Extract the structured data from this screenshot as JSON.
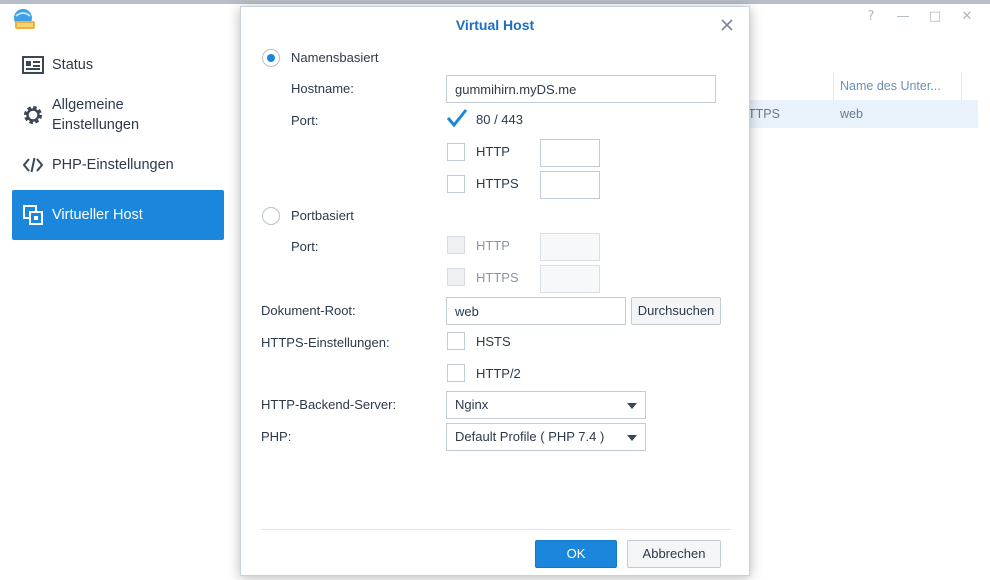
{
  "window": {
    "controls": [
      "?",
      "—",
      "□",
      "✕"
    ]
  },
  "sidebar": {
    "items": [
      {
        "label": "Status",
        "icon": "status-card-icon"
      },
      {
        "label": "Allgemeine Einstellungen",
        "line1": "Allgemeine",
        "line2": "Einstellungen",
        "icon": "gear-icon"
      },
      {
        "label": "PHP-Einstellungen",
        "icon": "code-brackets-icon"
      },
      {
        "label": "Virtueller Host",
        "icon": "virtual-host-icon",
        "active": true
      }
    ]
  },
  "background_table": {
    "headers": [
      "",
      "Name des Unter..."
    ],
    "rows": [
      [
        "TTPS",
        "web"
      ]
    ]
  },
  "dialog": {
    "title": "Virtual Host",
    "name_based": {
      "label": "Namensbasiert",
      "selected": true
    },
    "hostname": {
      "label": "Hostname:",
      "value": "gummihirn.myDS.me"
    },
    "port_label": "Port:",
    "port_default": {
      "label": "80 / 443",
      "checked": true
    },
    "port_http": {
      "label": "HTTP",
      "checked": false,
      "value": ""
    },
    "port_https": {
      "label": "HTTPS",
      "checked": false,
      "value": ""
    },
    "port_based": {
      "label": "Portbasiert",
      "selected": false
    },
    "pb_port_label": "Port:",
    "pb_http": {
      "label": "HTTP",
      "value": ""
    },
    "pb_https": {
      "label": "HTTPS",
      "value": ""
    },
    "docroot": {
      "label": "Dokument-Root:",
      "value": "web",
      "browse": "Durchsuchen"
    },
    "https_settings": {
      "label": "HTTPS-Einstellungen:",
      "hsts": "HSTS",
      "http2": "HTTP/2"
    },
    "backend": {
      "label": "HTTP-Backend-Server:",
      "value": "Nginx"
    },
    "php": {
      "label": "PHP:",
      "value": "Default Profile ( PHP 7.4 )"
    },
    "ok": "OK",
    "cancel": "Abbrechen"
  },
  "colors": {
    "accent": "#1a87dc",
    "title": "#1a6fc2"
  }
}
